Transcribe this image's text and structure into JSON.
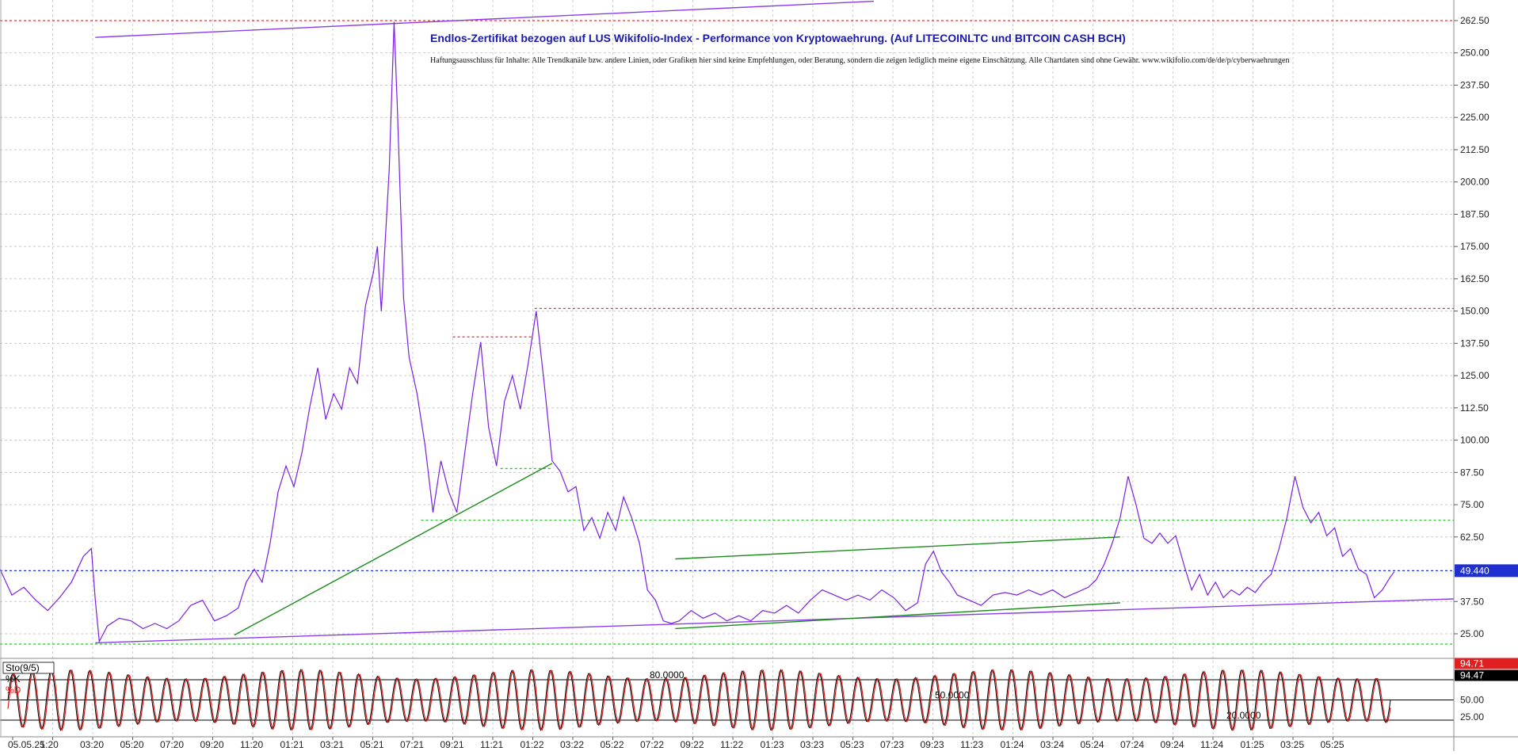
{
  "chart_data": [
    {
      "type": "line",
      "title": "Endlos-Zertifikat bezogen auf LUS Wikifolio-Index - Performance von Kryptowaehrung. (Auf LITECOINLTC und BITCOIN CASH BCH)",
      "subtitle": "Haftungsausschluss für Inhalte: Alle Trendkanäle bzw. andere Linien, oder Grafiken hier sind keine Empfehlungen, oder Beratung, sondern die zeigen lediglich meine eigene Einschätzung. Alle Chartdaten sind ohne Gewähr.  www.wikifolio.com/de/de/p/cyberwaehrungen",
      "xlabel": "",
      "ylabel": "",
      "ylim": [
        20,
        265
      ],
      "y_ticks": [
        "262.50",
        "250.00",
        "237.50",
        "225.00",
        "212.50",
        "200.00",
        "187.50",
        "175.00",
        "162.50",
        "150.00",
        "137.50",
        "125.00",
        "112.50",
        "100.00",
        "87.50",
        "75.00",
        "62.50",
        "49.440",
        "37.50",
        "25.00"
      ],
      "x_tick_labels": [
        "05.05.25",
        "1:20",
        "03:20",
        "05:20",
        "07:20",
        "09:20",
        "11:20",
        "01:21",
        "03:21",
        "05:21",
        "07:21",
        "09:21",
        "11:21",
        "01:22",
        "03:22",
        "05:22",
        "07:22",
        "09:22",
        "11:22",
        "01:23",
        "03:23",
        "05:23",
        "07:23",
        "09:23",
        "11:23",
        "01:24",
        "03:24",
        "05:24",
        "07:24",
        "09:24",
        "11:24",
        "01:25",
        "03:25",
        "05:25"
      ],
      "grid": true,
      "last_value": "49.440",
      "series": [
        {
          "color": "#7b1fe0",
          "points": [
            [
              0,
              50
            ],
            [
              1.5,
              40
            ],
            [
              3,
              43
            ],
            [
              4.5,
              38
            ],
            [
              6,
              34
            ],
            [
              7.5,
              39
            ],
            [
              9,
              45
            ],
            [
              10.5,
              55
            ],
            [
              11.5,
              58
            ],
            [
              12,
              38
            ],
            [
              12.5,
              22
            ],
            [
              13.5,
              28
            ],
            [
              15,
              31
            ],
            [
              16.5,
              30
            ],
            [
              18,
              27
            ],
            [
              19.5,
              29
            ],
            [
              21,
              27
            ],
            [
              22.5,
              30
            ],
            [
              24,
              36
            ],
            [
              25.5,
              38
            ],
            [
              27,
              30
            ],
            [
              28.5,
              32
            ],
            [
              30,
              35
            ],
            [
              31,
              45
            ],
            [
              32,
              50
            ],
            [
              33,
              45
            ],
            [
              34,
              60
            ],
            [
              35,
              80
            ],
            [
              36,
              90
            ],
            [
              37,
              82
            ],
            [
              38,
              95
            ],
            [
              39,
              113
            ],
            [
              40,
              128
            ],
            [
              41,
              108
            ],
            [
              42,
              118
            ],
            [
              43,
              112
            ],
            [
              44,
              128
            ],
            [
              45,
              122
            ],
            [
              46,
              152
            ],
            [
              47,
              165
            ],
            [
              47.5,
              175
            ],
            [
              48,
              150
            ],
            [
              49,
              205
            ],
            [
              49.6,
              262
            ],
            [
              50,
              230
            ],
            [
              50.8,
              155
            ],
            [
              51.5,
              132
            ],
            [
              52.5,
              118
            ],
            [
              53.5,
              98
            ],
            [
              54.5,
              72
            ],
            [
              55.5,
              92
            ],
            [
              56.5,
              80
            ],
            [
              57.5,
              72
            ],
            [
              58.5,
              95
            ],
            [
              59.5,
              118
            ],
            [
              60.5,
              138
            ],
            [
              61.5,
              105
            ],
            [
              62.5,
              90
            ],
            [
              63.5,
              115
            ],
            [
              64.5,
              125
            ],
            [
              65.5,
              112
            ],
            [
              66.5,
              130
            ],
            [
              67.5,
              150
            ],
            [
              68.5,
              122
            ],
            [
              69.5,
              92
            ],
            [
              70.5,
              88
            ],
            [
              71.5,
              80
            ],
            [
              72.5,
              82
            ],
            [
              73.5,
              65
            ],
            [
              74.5,
              70
            ],
            [
              75.5,
              62
            ],
            [
              76.5,
              72
            ],
            [
              77.5,
              65
            ],
            [
              78.5,
              78
            ],
            [
              79.5,
              70
            ],
            [
              80.5,
              60
            ],
            [
              81.5,
              42
            ],
            [
              82.5,
              38
            ],
            [
              83.5,
              30
            ],
            [
              84.5,
              29
            ],
            [
              85.5,
              30
            ],
            [
              87,
              34
            ],
            [
              88.5,
              31
            ],
            [
              90,
              33
            ],
            [
              91.5,
              30
            ],
            [
              93,
              32
            ],
            [
              94.5,
              30
            ],
            [
              96,
              34
            ],
            [
              97.5,
              33
            ],
            [
              99,
              36
            ],
            [
              100.5,
              33
            ],
            [
              102,
              38
            ],
            [
              103.5,
              42
            ],
            [
              105,
              40
            ],
            [
              106.5,
              38
            ],
            [
              108,
              40
            ],
            [
              109.5,
              38
            ],
            [
              111,
              42
            ],
            [
              112.5,
              39
            ],
            [
              114,
              34
            ],
            [
              115.5,
              37
            ],
            [
              116.5,
              52
            ],
            [
              117.5,
              57
            ],
            [
              118.5,
              49
            ],
            [
              119.5,
              45
            ],
            [
              120.5,
              40
            ],
            [
              122,
              38
            ],
            [
              123.5,
              36
            ],
            [
              125,
              40
            ],
            [
              126.5,
              41
            ],
            [
              128,
              40
            ],
            [
              129.5,
              42
            ],
            [
              131,
              40
            ],
            [
              132.5,
              42
            ],
            [
              134,
              39
            ],
            [
              135.5,
              41
            ],
            [
              137,
              43
            ],
            [
              138,
              46
            ],
            [
              139,
              52
            ],
            [
              140,
              60
            ],
            [
              141,
              70
            ],
            [
              142,
              86
            ],
            [
              143,
              75
            ],
            [
              144,
              62
            ],
            [
              145,
              60
            ],
            [
              146,
              64
            ],
            [
              147,
              60
            ],
            [
              148,
              63
            ],
            [
              149,
              52
            ],
            [
              150,
              42
            ],
            [
              151,
              48
            ],
            [
              152,
              40
            ],
            [
              153,
              45
            ],
            [
              154,
              39
            ],
            [
              155,
              42
            ],
            [
              156,
              40
            ],
            [
              157,
              43
            ],
            [
              158,
              41
            ],
            [
              159,
              45
            ],
            [
              160,
              48
            ],
            [
              161,
              58
            ],
            [
              162,
              70
            ],
            [
              163,
              86
            ],
            [
              164,
              74
            ],
            [
              165,
              68
            ],
            [
              166,
              72
            ],
            [
              167,
              63
            ],
            [
              168,
              66
            ],
            [
              169,
              55
            ],
            [
              170,
              58
            ],
            [
              171,
              50
            ],
            [
              172,
              48
            ],
            [
              173,
              39
            ],
            [
              174,
              42
            ],
            [
              175,
              47
            ],
            [
              175.5,
              49
            ]
          ]
        }
      ],
      "horizontal_levels": [
        {
          "value": 262.5,
          "color": "#e83030",
          "style": "dotted"
        },
        {
          "value": 151,
          "color": "#e83030",
          "style": "dotted"
        },
        {
          "value": 140,
          "color": "#e83030",
          "style": "dotted"
        },
        {
          "value": 89,
          "color": "#2fbf2f",
          "style": "dotted"
        },
        {
          "value": 69,
          "color": "#2fbf2f",
          "style": "dotted"
        },
        {
          "value": 49.44,
          "color": "#1f2fd0",
          "style": "dotted"
        },
        {
          "value": 21,
          "color": "#2fbf2f",
          "style": "dotted"
        }
      ],
      "trendlines": [
        {
          "from": [
            12,
            256
          ],
          "to": [
            110,
            270
          ],
          "color": "#8a3de6"
        },
        {
          "from": [
            12,
            21.5
          ],
          "to": [
            183,
            38.5
          ],
          "color": "#8a3de6"
        },
        {
          "from": [
            29.5,
            24.5
          ],
          "to": [
            69.5,
            91
          ],
          "color": "#1c8c1c"
        },
        {
          "from": [
            85,
            27
          ],
          "to": [
            141,
            37
          ],
          "color": "#1c8c1c"
        },
        {
          "from": [
            85,
            54
          ],
          "to": [
            141,
            62.5
          ],
          "color": "#1c8c1c"
        }
      ]
    },
    {
      "type": "line",
      "title": "Sto(9/5)",
      "ylim": [
        10,
        100
      ],
      "y_ticks": [
        "50.00",
        "25.00"
      ],
      "levels": [
        {
          "value": 80,
          "label": "80.0000"
        },
        {
          "value": 50,
          "label": "50.0000"
        },
        {
          "value": 20,
          "label": "20.0000"
        }
      ],
      "last_values": {
        "k": "94.47",
        "d": "94.71"
      },
      "series": [
        {
          "name": "%K",
          "color": "#000000"
        },
        {
          "name": "%D",
          "color": "#e02020"
        }
      ]
    }
  ]
}
